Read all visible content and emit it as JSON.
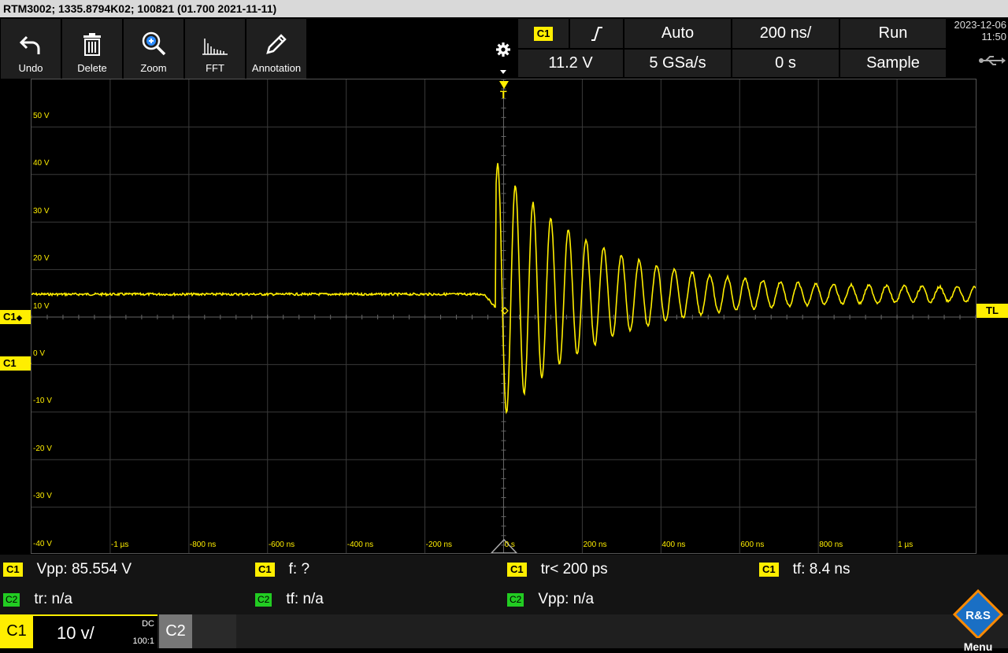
{
  "titlebar": {
    "text": "RTM3002; 1335.8794K02; 100821 (01.700 2021-11-11)"
  },
  "toolbar": {
    "undo": "Undo",
    "delete": "Delete",
    "zoom": "Zoom",
    "fft": "FFT",
    "annotation": "Annotation"
  },
  "trigger": {
    "channel": "C1",
    "mode": "Auto",
    "timebase": "200 ns/",
    "run_state": "Run",
    "level": "11.2 V",
    "sample_rate": "5 GSa/s",
    "offset": "0 s",
    "acquisition": "Sample"
  },
  "datetime": {
    "date": "2023-12-06",
    "time": "11:50"
  },
  "plot": {
    "y_ticks": [
      "50 V",
      "40 V",
      "30 V",
      "20 V",
      "10 V",
      "0 V",
      "-10 V",
      "-20 V",
      "-30 V",
      "-40 V"
    ],
    "x_ticks": [
      "-1 µs",
      "-800 ns",
      "-600 ns",
      "-400 ns",
      "-200 ns",
      "0 s",
      "200 ns",
      "400 ns",
      "600 ns",
      "800 ns",
      "1 µs"
    ],
    "trigger_marker": "T",
    "trigger_level_marker": "TL",
    "ch_offset_marker": "C1",
    "ch_ground_marker": "C1",
    "trace_color": "#ffee00"
  },
  "measurements": [
    {
      "ch": "C1",
      "text": "Vpp: 85.554 V"
    },
    {
      "ch": "C1",
      "text": "f: ?"
    },
    {
      "ch": "C1",
      "text": "tr< 200 ps"
    },
    {
      "ch": "C1",
      "text": "tf: 8.4 ns"
    },
    {
      "ch": "C2",
      "text": "tr: n/a"
    },
    {
      "ch": "C2",
      "text": "tf: n/a"
    },
    {
      "ch": "C2",
      "text": "Vpp: n/a"
    }
  ],
  "bottom": {
    "c1_label": "C1",
    "c1_scale": "10 v/",
    "c1_coupling": "DC",
    "c1_probe": "100:1",
    "c2_label": "C2",
    "menu": "Menu",
    "logo": "R&S"
  }
}
